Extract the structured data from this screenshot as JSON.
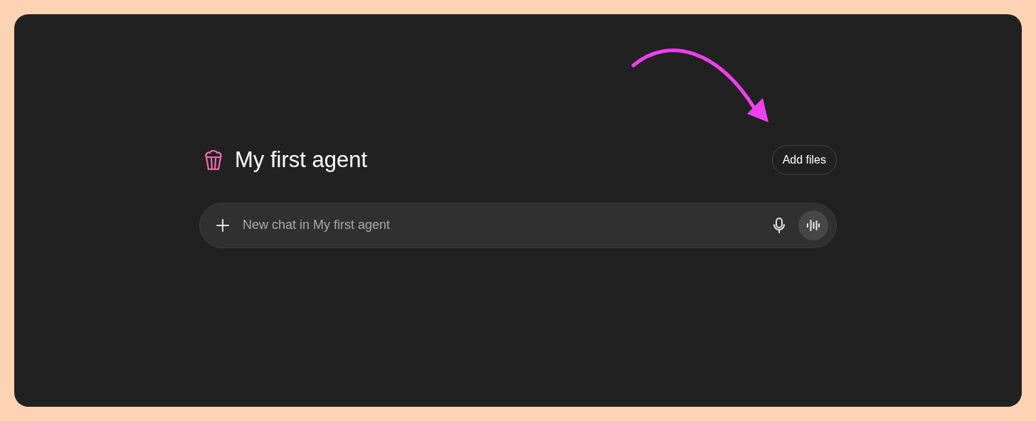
{
  "agent": {
    "title": "My first agent"
  },
  "add_files_button": {
    "label": "Add files"
  },
  "composer": {
    "placeholder": "New chat in My first agent"
  }
}
